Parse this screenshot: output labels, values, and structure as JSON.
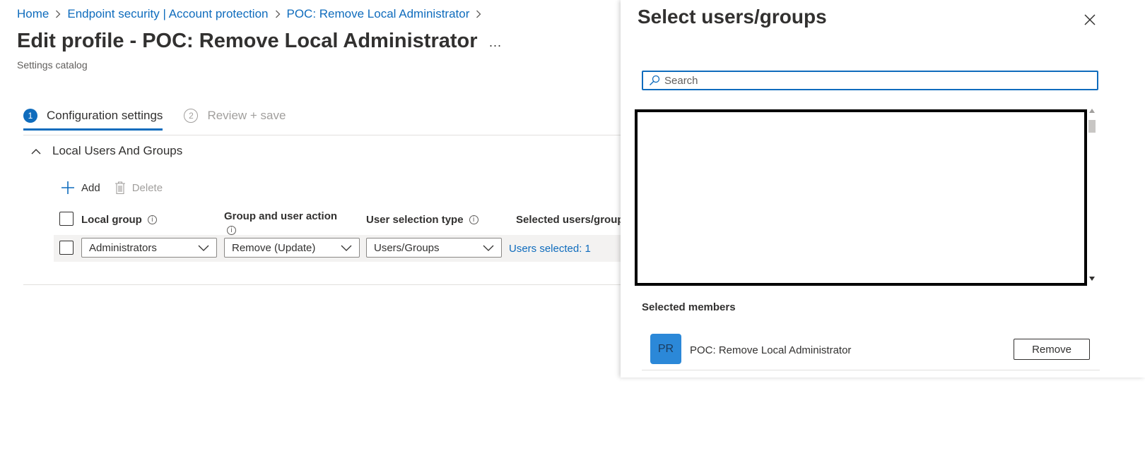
{
  "breadcrumb": {
    "items": [
      "Home",
      "Endpoint security | Account protection",
      "POC: Remove Local Administrator"
    ]
  },
  "page": {
    "title": "Edit profile - POC: Remove Local Administrator",
    "more": "...",
    "subtitle": "Settings catalog"
  },
  "wizard": {
    "steps": [
      {
        "num": "1",
        "label": "Configuration settings",
        "state": "active"
      },
      {
        "num": "2",
        "label": "Review + save",
        "state": "inactive"
      }
    ]
  },
  "section": {
    "title": "Local Users And Groups"
  },
  "toolbar": {
    "add_label": "Add",
    "delete_label": "Delete"
  },
  "grid": {
    "columns": [
      "Local group",
      "Group and user action",
      "User selection type",
      "Selected users/group"
    ],
    "row": {
      "local_group": "Administrators",
      "action": "Remove (Update)",
      "selection_type": "Users/Groups",
      "selected": "Users selected: 1"
    }
  },
  "panel": {
    "title": "Select users/groups",
    "search_placeholder": "Search",
    "selected_heading": "Selected members",
    "member": {
      "initials": "PR",
      "name": "POC: Remove Local Administrator",
      "remove_label": "Remove"
    }
  },
  "colors": {
    "accent": "#0f6cbd",
    "avatar": "#2b88d8",
    "row_bg": "#f3f2f1"
  },
  "icons": [
    "chevron-right-icon",
    "chevron-up-icon",
    "plus-icon",
    "trash-icon",
    "info-icon",
    "chevron-down-icon",
    "close-icon",
    "search-icon"
  ]
}
